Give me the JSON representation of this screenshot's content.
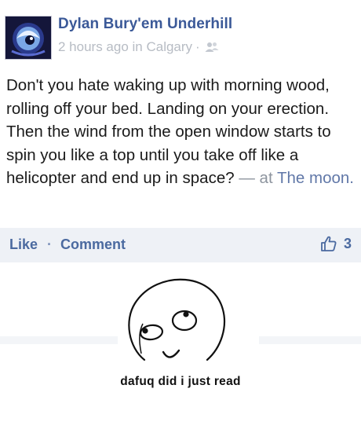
{
  "post": {
    "author": "Dylan Bury'em Underhill",
    "time": "2 hours ago in Calgary",
    "separator": "·",
    "text": "Don't you hate waking up with morning wood, rolling off your bed. Landing on your erection. Then the wind from the open window starts to spin you like a top until you take off like a helicopter and end up in space?",
    "at_prefix": "— at",
    "location": "The moon."
  },
  "actions": {
    "like_label": "Like",
    "separator": "·",
    "comment_label": "Comment",
    "like_count": "3"
  },
  "image": {
    "caption": "dafuq did i just read"
  },
  "colors": {
    "link": "#3b5998",
    "meta": "#b7bcc4",
    "action_bar": "#eef1f6"
  },
  "icons": [
    "friends-icon",
    "thumbs-up-icon",
    "avatar-image",
    "meme-face"
  ]
}
